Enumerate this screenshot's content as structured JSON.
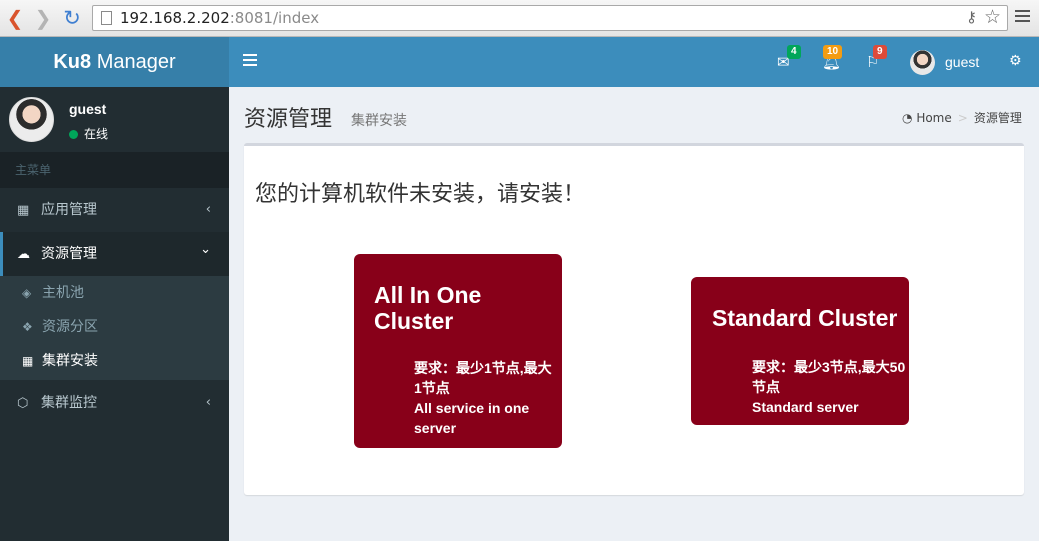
{
  "browser": {
    "url_host": "192.168.2.202",
    "url_rest": ":8081/index"
  },
  "app": {
    "brand_bold": "Ku8",
    "brand_rest": " Manager"
  },
  "topbar": {
    "messages_count": "4",
    "notifications_count": "10",
    "tasks_count": "9",
    "user_name": "guest"
  },
  "sidebar": {
    "user_name": "guest",
    "status": "在线",
    "header": "主菜单",
    "items": [
      {
        "label": "应用管理",
        "icon": "th-icon",
        "chevron": "‹"
      },
      {
        "label": "资源管理",
        "icon": "cloud-icon",
        "chevron": "⌄"
      },
      {
        "label": "集群监控",
        "icon": "codepen-icon",
        "chevron": "‹"
      }
    ],
    "submenu": [
      {
        "label": "主机池",
        "icon": "cube-icon"
      },
      {
        "label": "资源分区",
        "icon": "cubes-icon"
      },
      {
        "label": "集群安装",
        "icon": "th-icon"
      }
    ]
  },
  "content": {
    "title": "资源管理",
    "subtitle": "集群安装",
    "breadcrumb_home": "Home",
    "breadcrumb_current": "资源管理",
    "message": "您的计算机软件未安装，请安装！",
    "cards": [
      {
        "title": "All In One Cluster",
        "req": "要求：最少1节点,最大1节点",
        "desc": "All service in one server"
      },
      {
        "title": "Standard Cluster",
        "req": "要求：最少3节点,最大50节点",
        "desc": "Standard server"
      }
    ]
  },
  "colors": {
    "header_blue": "#3c8dbc",
    "logo_blue": "#367fa9",
    "sidebar_dark": "#222d32",
    "card_red": "#880019"
  }
}
